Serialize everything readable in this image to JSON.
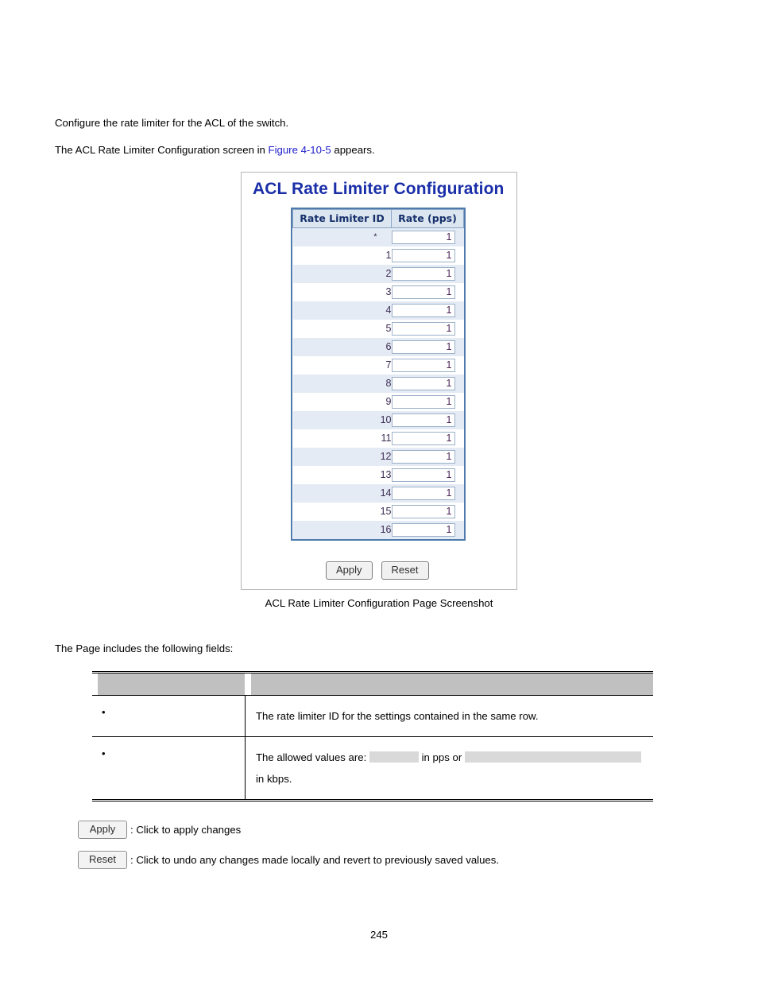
{
  "document": {
    "intro_line_1": "Configure the rate limiter for the ACL of the switch.",
    "intro_line_2_prefix": "The ACL Rate Limiter Configuration screen in ",
    "intro_figure_link": "Figure 4-10-5",
    "intro_line_2_suffix": " appears.",
    "caption": "ACL Rate Limiter Configuration Page Screenshot",
    "fields_lead": "The Page includes the following fields:",
    "page_number": "245"
  },
  "screenshot": {
    "title": "ACL Rate Limiter Configuration",
    "title_color": "#1a2ea8",
    "table": {
      "headers": [
        "Rate Limiter ID",
        "Rate (pps)"
      ],
      "rows": [
        {
          "id": "*",
          "rate": "1"
        },
        {
          "id": "1",
          "rate": "1"
        },
        {
          "id": "2",
          "rate": "1"
        },
        {
          "id": "3",
          "rate": "1"
        },
        {
          "id": "4",
          "rate": "1"
        },
        {
          "id": "5",
          "rate": "1"
        },
        {
          "id": "6",
          "rate": "1"
        },
        {
          "id": "7",
          "rate": "1"
        },
        {
          "id": "8",
          "rate": "1"
        },
        {
          "id": "9",
          "rate": "1"
        },
        {
          "id": "10",
          "rate": "1"
        },
        {
          "id": "11",
          "rate": "1"
        },
        {
          "id": "12",
          "rate": "1"
        },
        {
          "id": "13",
          "rate": "1"
        },
        {
          "id": "14",
          "rate": "1"
        },
        {
          "id": "15",
          "rate": "1"
        },
        {
          "id": "16",
          "rate": "1"
        }
      ]
    },
    "buttons": {
      "apply": "Apply",
      "reset": "Reset"
    }
  },
  "fields_table": {
    "header": {
      "col_label": "",
      "col_description": ""
    },
    "rows": [
      {
        "label": "",
        "bullet": "",
        "description": "The rate limiter ID for the settings contained in the same row."
      },
      {
        "label": "",
        "bullet": "",
        "desc_part_1": "The allowed values are:",
        "desc_part_2": "in pps or",
        "desc_part_3": "in",
        "desc_part_4": "kbps."
      }
    ]
  },
  "legend": {
    "apply_button": "Apply",
    "apply_text": ": Click to apply changes",
    "reset_button": "Reset",
    "reset_text": ": Click to undo any changes made locally and revert to previously saved values."
  }
}
